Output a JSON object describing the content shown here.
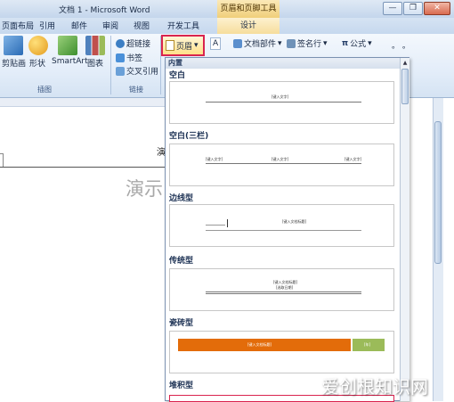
{
  "window": {
    "title": "文档 1 - Microsoft Word",
    "context_tab_title": "页眉和页脚工具",
    "buttons": {
      "minimize": "—",
      "restore": "❐",
      "close": "✕"
    }
  },
  "tabs": {
    "page_layout": "页面布局",
    "references": "引用",
    "mailings": "邮件",
    "review": "审阅",
    "view": "视图",
    "developer": "开发工具",
    "design": "设计"
  },
  "ribbon": {
    "clipart": "剪贴画",
    "shapes": "形状",
    "smartart": "SmartArt",
    "chart": "图表",
    "hyperlink": "超链接",
    "bookmark": "书签",
    "crossref": "交叉引用",
    "header": "页眉",
    "textbox_icon": "A",
    "doc_parts": "文档部件",
    "signature_line": "签名行",
    "equation": "公式",
    "dots": "。 。",
    "group_illustrations": "插图",
    "group_links": "链接"
  },
  "document": {
    "demo_heading": "演",
    "demo_body": "演示"
  },
  "gallery": {
    "header": "内置",
    "sections": {
      "blank": "空白",
      "blank_three": "空白(三栏)",
      "border": "边线型",
      "traditional": "传统型",
      "tile": "瓷砖型",
      "stack": "堆积型"
    },
    "placeholders": {
      "type_text": "[键入文字]",
      "type_title": "[键入文档标题]",
      "type_title_short": "[键入文档标题]",
      "select_date": "[选取日期]",
      "year": "[年]"
    }
  },
  "watermark": "爱创根知识网",
  "colors": {
    "tile_orange": "#e36c0a",
    "tile_green": "#9bbb59",
    "highlight_red": "#d9244f"
  }
}
